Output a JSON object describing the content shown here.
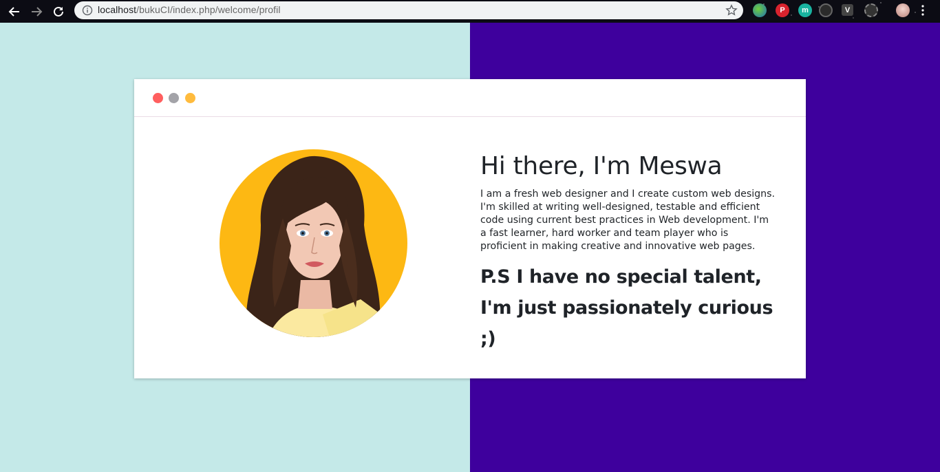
{
  "browser": {
    "url_host": "localhost",
    "url_path": "/bukuCI/index.php/welcome/profil",
    "back_icon": "arrow-left-icon",
    "forward_icon": "arrow-right-icon",
    "reload_icon": "reload-icon",
    "info_icon": "info-icon",
    "bookmark_icon": "star-icon",
    "extensions": [
      "globe-extension-icon",
      "pinterest-icon",
      "m-extension-icon",
      "circle-extension-icon",
      "v-extension-icon",
      "gear-extension-icon",
      "profile-avatar-icon",
      "more-menu-icon"
    ],
    "extension_labels": {
      "pinterest": "P",
      "m": "m",
      "v": "V"
    }
  },
  "colors": {
    "bg_left": "#c4e9e8",
    "bg_right": "#3e009d",
    "card": "#ffffff",
    "dot_red": "#ff5f5f",
    "dot_gray": "#a3a3a8",
    "dot_yellow": "#ffbb3d",
    "avatar_bg": "#fdb813"
  },
  "profile": {
    "headline": "Hi there, I'm Meswa",
    "bio": "I am a fresh web designer and I create custom web designs. I'm skilled at writing well-designed, testable and efficient code using current best practices in Web development. I'm a fast learner, hard worker and team player who is proficient in making creative and innovative web pages.",
    "ps": "P.S I have no special talent, I'm just passionately curious ;)",
    "avatar_icon": "profile-photo"
  }
}
